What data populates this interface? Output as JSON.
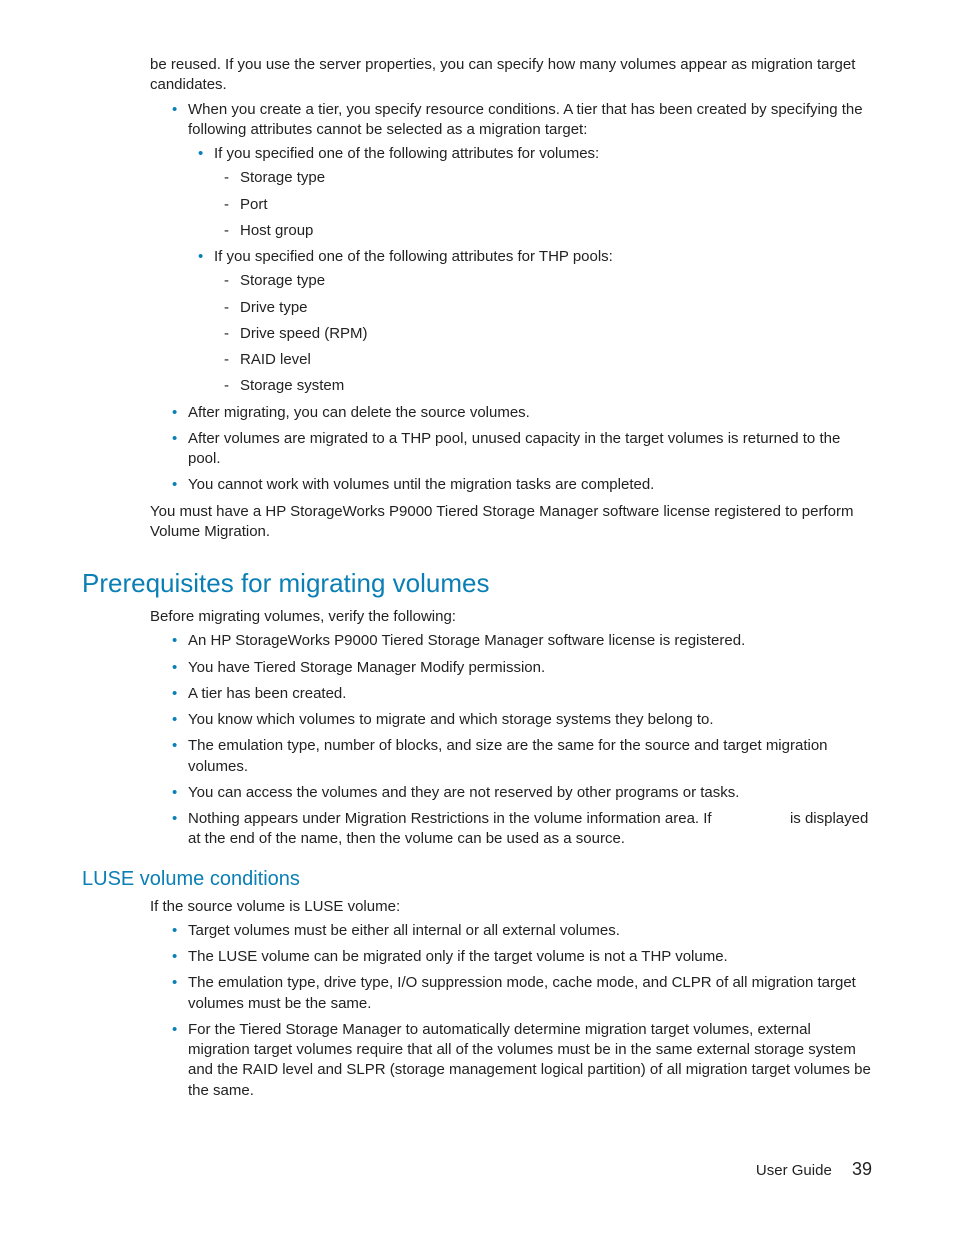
{
  "section1": {
    "p_cont": "be reused. If you use the server properties, you can specify how many volumes appear as migration target candidates.",
    "l2": "When you create a tier, you specify resource conditions. A tier that has been created by specifying the following attributes cannot be selected as a migration target:",
    "l2a": "If you specified one of the following attributes for volumes:",
    "l2a_items": {
      "a": "Storage type",
      "b": "Port",
      "c": "Host group"
    },
    "l2b": "If you specified one of the following attributes for THP pools:",
    "l2b_items": {
      "a": "Storage type",
      "b": "Drive type",
      "c": "Drive speed (RPM)",
      "d": "RAID level",
      "e": "Storage system"
    },
    "l3": "After migrating, you can delete the source volumes.",
    "l4": "After volumes are migrated to a THP pool, unused capacity in the target volumes is returned to the pool.",
    "l5": "You cannot work with volumes until the migration tasks are completed.",
    "p_end": "You must have a HP StorageWorks P9000 Tiered Storage Manager software license registered to perform Volume Migration."
  },
  "prereq": {
    "heading": "Prerequisites for migrating volumes",
    "intro": "Before migrating volumes, verify the following:",
    "items": {
      "a": "An HP StorageWorks P9000 Tiered Storage Manager software license is registered.",
      "b": "You have Tiered Storage Manager Modify permission.",
      "c": "A tier has been created.",
      "d": "You know which volumes to migrate and which storage systems they belong to.",
      "e": "The emulation type, number of blocks, and size are the same for the source and target migration volumes.",
      "f": "You can access the volumes and they are not reserved by other programs or tasks.",
      "g1": "Nothing appears under Migration Restrictions in the volume information area. If ",
      "g2": " is displayed at the end of the name, then the volume can be used as a source."
    }
  },
  "luse": {
    "heading": "LUSE volume conditions",
    "intro": "If the source volume is LUSE volume:",
    "items": {
      "a": "Target volumes must be either all internal or all external volumes.",
      "b": "The LUSE volume can be migrated only if the target volume is not a THP volume.",
      "c": "The emulation type, drive type, I/O suppression mode, cache mode, and CLPR of all migration target volumes must be the same.",
      "d": "For the Tiered Storage Manager to automatically determine migration target volumes, external migration target volumes require that all of the volumes must be in the same external storage system and the RAID level and SLPR (storage management logical partition) of all migration target volumes be the same."
    }
  },
  "footer": {
    "label": "User Guide",
    "page": "39"
  }
}
